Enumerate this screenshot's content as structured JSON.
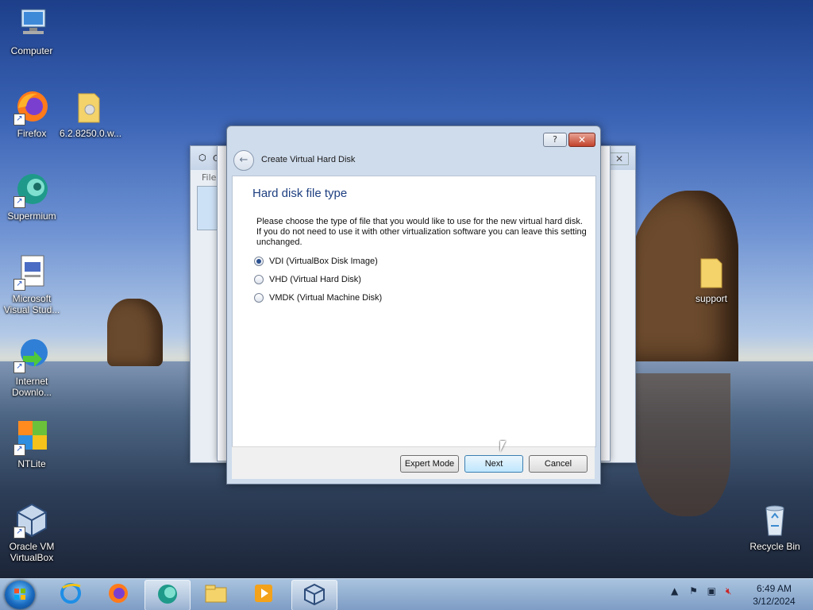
{
  "desktop": {
    "icons": [
      {
        "label": "Computer",
        "icon": "computer-icon"
      },
      {
        "label": "Firefox",
        "icon": "firefox-icon"
      },
      {
        "label": "6.2.8250.0.w...",
        "icon": "folder-icon"
      },
      {
        "label": "Supermium",
        "icon": "supermium-icon"
      },
      {
        "label": "Microsoft Visual Stud...",
        "icon": "visual-studio-icon"
      },
      {
        "label": "Internet Downlo...",
        "icon": "internet-download-manager-icon"
      },
      {
        "label": "NTLite",
        "icon": "ntlite-icon"
      },
      {
        "label": "Oracle VM VirtualBox",
        "icon": "virtualbox-icon"
      },
      {
        "label": "support",
        "icon": "folder-icon"
      },
      {
        "label": "Recycle Bin",
        "icon": "recycle-bin-icon"
      }
    ]
  },
  "background_window": {
    "menu_first": "File",
    "title_first": "C"
  },
  "dialog": {
    "help_label": "?",
    "close_label": "✕",
    "back_icon": "back-arrow-icon",
    "title": "Create Virtual Hard Disk",
    "heading": "Hard disk file type",
    "description": "Please choose the type of file that you would like to use for the new virtual hard disk. If you do not need to use it with other virtualization software you can leave this setting unchanged.",
    "options": [
      {
        "label": "VDI (VirtualBox Disk Image)",
        "selected": true
      },
      {
        "label": "VHD (Virtual Hard Disk)",
        "selected": false
      },
      {
        "label": "VMDK (Virtual Machine Disk)",
        "selected": false
      }
    ],
    "buttons": {
      "expert": "Expert Mode",
      "next": "Next",
      "cancel": "Cancel"
    }
  },
  "taskbar": {
    "pinned": [
      "internet-explorer-icon",
      "firefox-icon",
      "supermium-icon",
      "file-explorer-icon",
      "media-player-icon",
      "virtualbox-icon"
    ],
    "tray_icons": [
      "show-hidden-icon",
      "action-center-flag-icon",
      "network-icon",
      "volume-muted-icon"
    ],
    "clock_time": "6:49 AM",
    "clock_date": "3/12/2024"
  }
}
